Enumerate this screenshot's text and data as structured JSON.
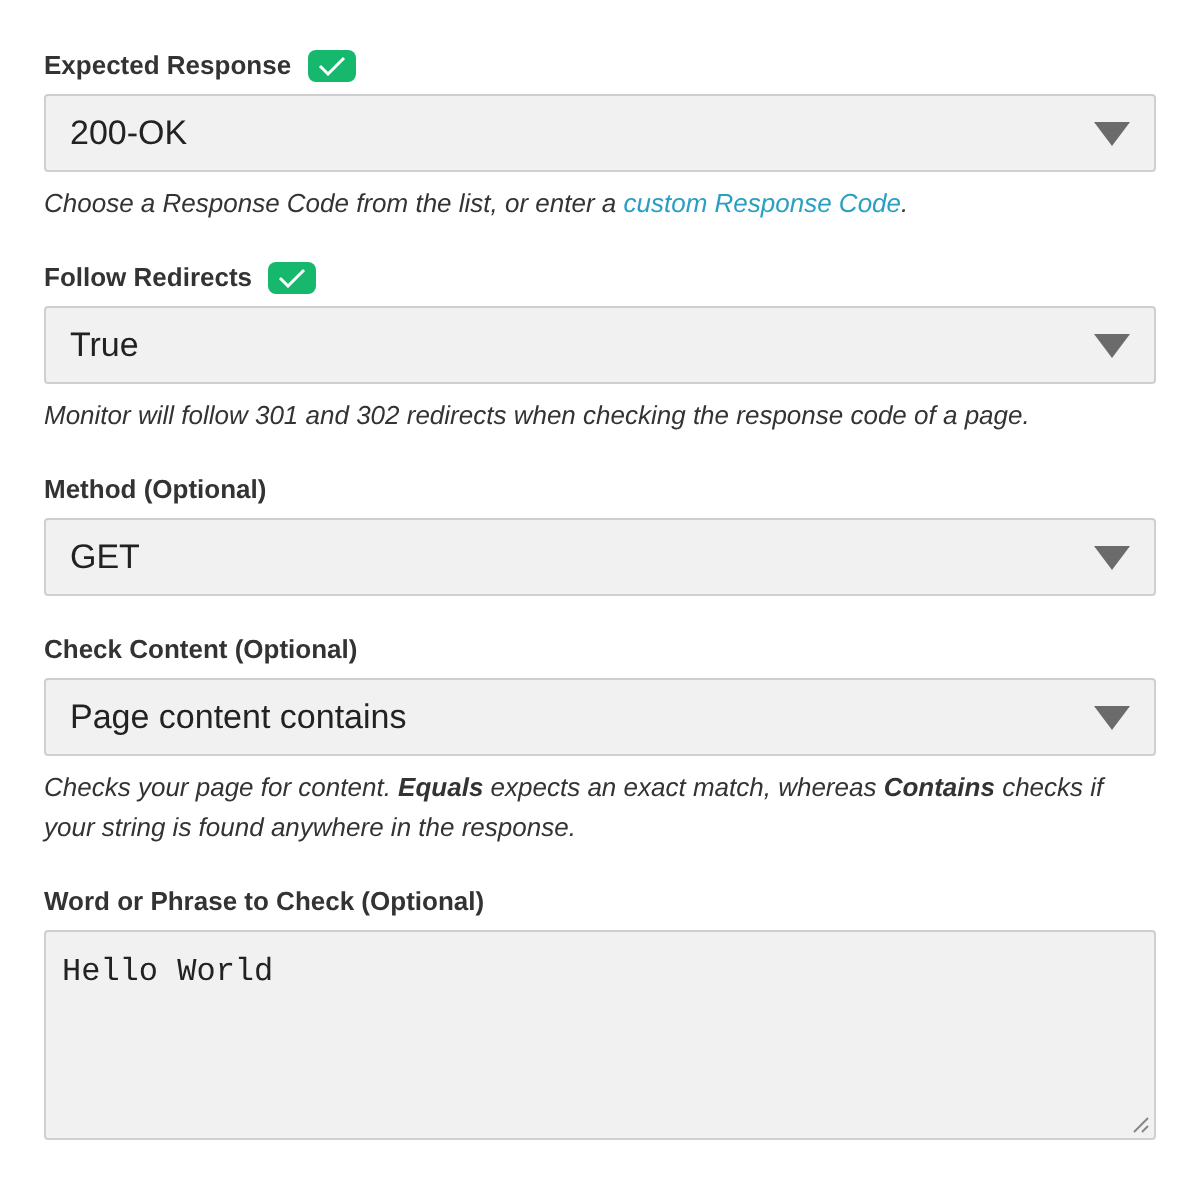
{
  "fields": [
    {
      "kind": "select",
      "label": "Expected Response",
      "checked": true,
      "value": "200-OK",
      "help": [
        {
          "kind": "text",
          "text": "Choose a Response Code from the list, or enter a "
        },
        {
          "kind": "link",
          "text": "custom Response Code"
        },
        {
          "kind": "text",
          "text": "."
        }
      ]
    },
    {
      "kind": "select",
      "label": "Follow Redirects",
      "checked": true,
      "value": "True",
      "help": [
        {
          "kind": "text",
          "text": "Monitor will follow 301 and 302 redirects when checking the response code of a page."
        }
      ]
    },
    {
      "kind": "select",
      "label": "Method (Optional)",
      "checked": false,
      "value": "GET"
    },
    {
      "kind": "select",
      "label": "Check Content (Optional)",
      "checked": false,
      "value": "Page content contains",
      "help": [
        {
          "kind": "text",
          "text": "Checks your page for content. **Equals** expects an exact match, whereas **Contains** checks if your string is found anywhere in the response."
        }
      ]
    },
    {
      "kind": "textarea",
      "label": "Word or Phrase to Check (Optional)",
      "checked": false,
      "value": "Hello World"
    }
  ]
}
